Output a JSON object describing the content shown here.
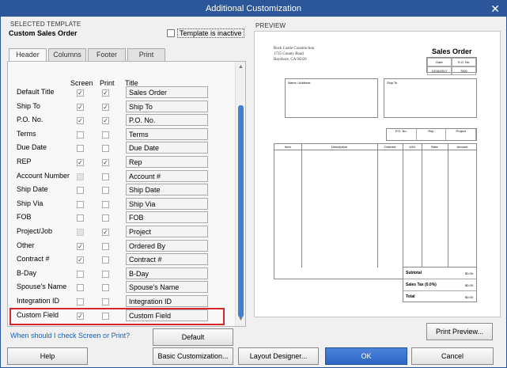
{
  "window": {
    "title": "Additional Customization",
    "close_glyph": "✕"
  },
  "selected_template": {
    "section_label": "SELECTED TEMPLATE",
    "name": "Custom Sales Order",
    "inactive_label": "Template is inactive",
    "inactive_checked": false
  },
  "tabs": [
    {
      "label": "Header",
      "active": true
    },
    {
      "label": "Columns",
      "active": false
    },
    {
      "label": "Footer",
      "active": false
    },
    {
      "label": "Print",
      "active": false
    }
  ],
  "columns": {
    "screen": "Screen",
    "print": "Print",
    "title": "Title"
  },
  "fields": [
    {
      "label": "Default Title",
      "screen": true,
      "print": true,
      "title": "Sales Order"
    },
    {
      "label": "Ship To",
      "screen": true,
      "print": true,
      "title": "Ship To"
    },
    {
      "label": "P.O. No.",
      "screen": true,
      "print": true,
      "title": "P.O. No."
    },
    {
      "label": "Terms",
      "screen": false,
      "print": false,
      "title": "Terms"
    },
    {
      "label": "Due Date",
      "screen": false,
      "print": false,
      "title": "Due Date"
    },
    {
      "label": "REP",
      "screen": true,
      "print": true,
      "title": "Rep"
    },
    {
      "label": "Account Number",
      "screen": false,
      "print": false,
      "title": "Account #",
      "screen_disabled": true
    },
    {
      "label": "Ship Date",
      "screen": false,
      "print": false,
      "title": "Ship Date"
    },
    {
      "label": "Ship Via",
      "screen": false,
      "print": false,
      "title": "Ship Via"
    },
    {
      "label": "FOB",
      "screen": false,
      "print": false,
      "title": "FOB"
    },
    {
      "label": "Project/Job",
      "screen": false,
      "print": true,
      "title": "Project",
      "screen_disabled": true
    },
    {
      "label": "Other",
      "screen": true,
      "print": false,
      "title": "Ordered By"
    },
    {
      "label": "Contract #",
      "screen": true,
      "print": false,
      "title": "Contract #"
    },
    {
      "label": "B-Day",
      "screen": false,
      "print": false,
      "title": "B-Day"
    },
    {
      "label": "Spouse's Name",
      "screen": false,
      "print": false,
      "title": "Spouse's Name"
    },
    {
      "label": "Integration ID",
      "screen": false,
      "print": false,
      "title": "Integration ID"
    },
    {
      "label": "Custom Field",
      "screen": true,
      "print": false,
      "title": "Custom Field"
    }
  ],
  "links": {
    "help_check": "When should I check Screen or Print?"
  },
  "buttons": {
    "default": "Default",
    "print_preview": "Print Preview...",
    "help": "Help",
    "basic_customization": "Basic Customization...",
    "layout_designer": "Layout Designer...",
    "ok": "OK",
    "cancel": "Cancel"
  },
  "preview": {
    "section_label": "PREVIEW",
    "company": [
      "Rock Castle Construction",
      "1735 County Road",
      "Bayshore, CA 94326"
    ],
    "doc_title": "Sales Order",
    "date_headers": [
      "Date",
      "S.O. No."
    ],
    "date_values": [
      "12/15/2017",
      "7001"
    ],
    "name_address": "Name / Address",
    "ship_to": "Ship To",
    "po_headers": [
      "P.O. No.",
      "Rep",
      "Project"
    ],
    "item_headers": [
      "Item",
      "Description",
      "Ordered",
      "U/M",
      "Rate",
      "Amount"
    ],
    "totals": [
      {
        "label": "Subtotal",
        "value": "$0.00"
      },
      {
        "label": "Sales Tax  (0.0%)",
        "value": "$0.00"
      },
      {
        "label": "Total",
        "value": "$0.00"
      }
    ]
  },
  "colors": {
    "titlebar": "#2b579a",
    "highlight": "#d9242b",
    "ok_button": "#2e66c4",
    "scroll_thumb": "#3f7fd8"
  }
}
